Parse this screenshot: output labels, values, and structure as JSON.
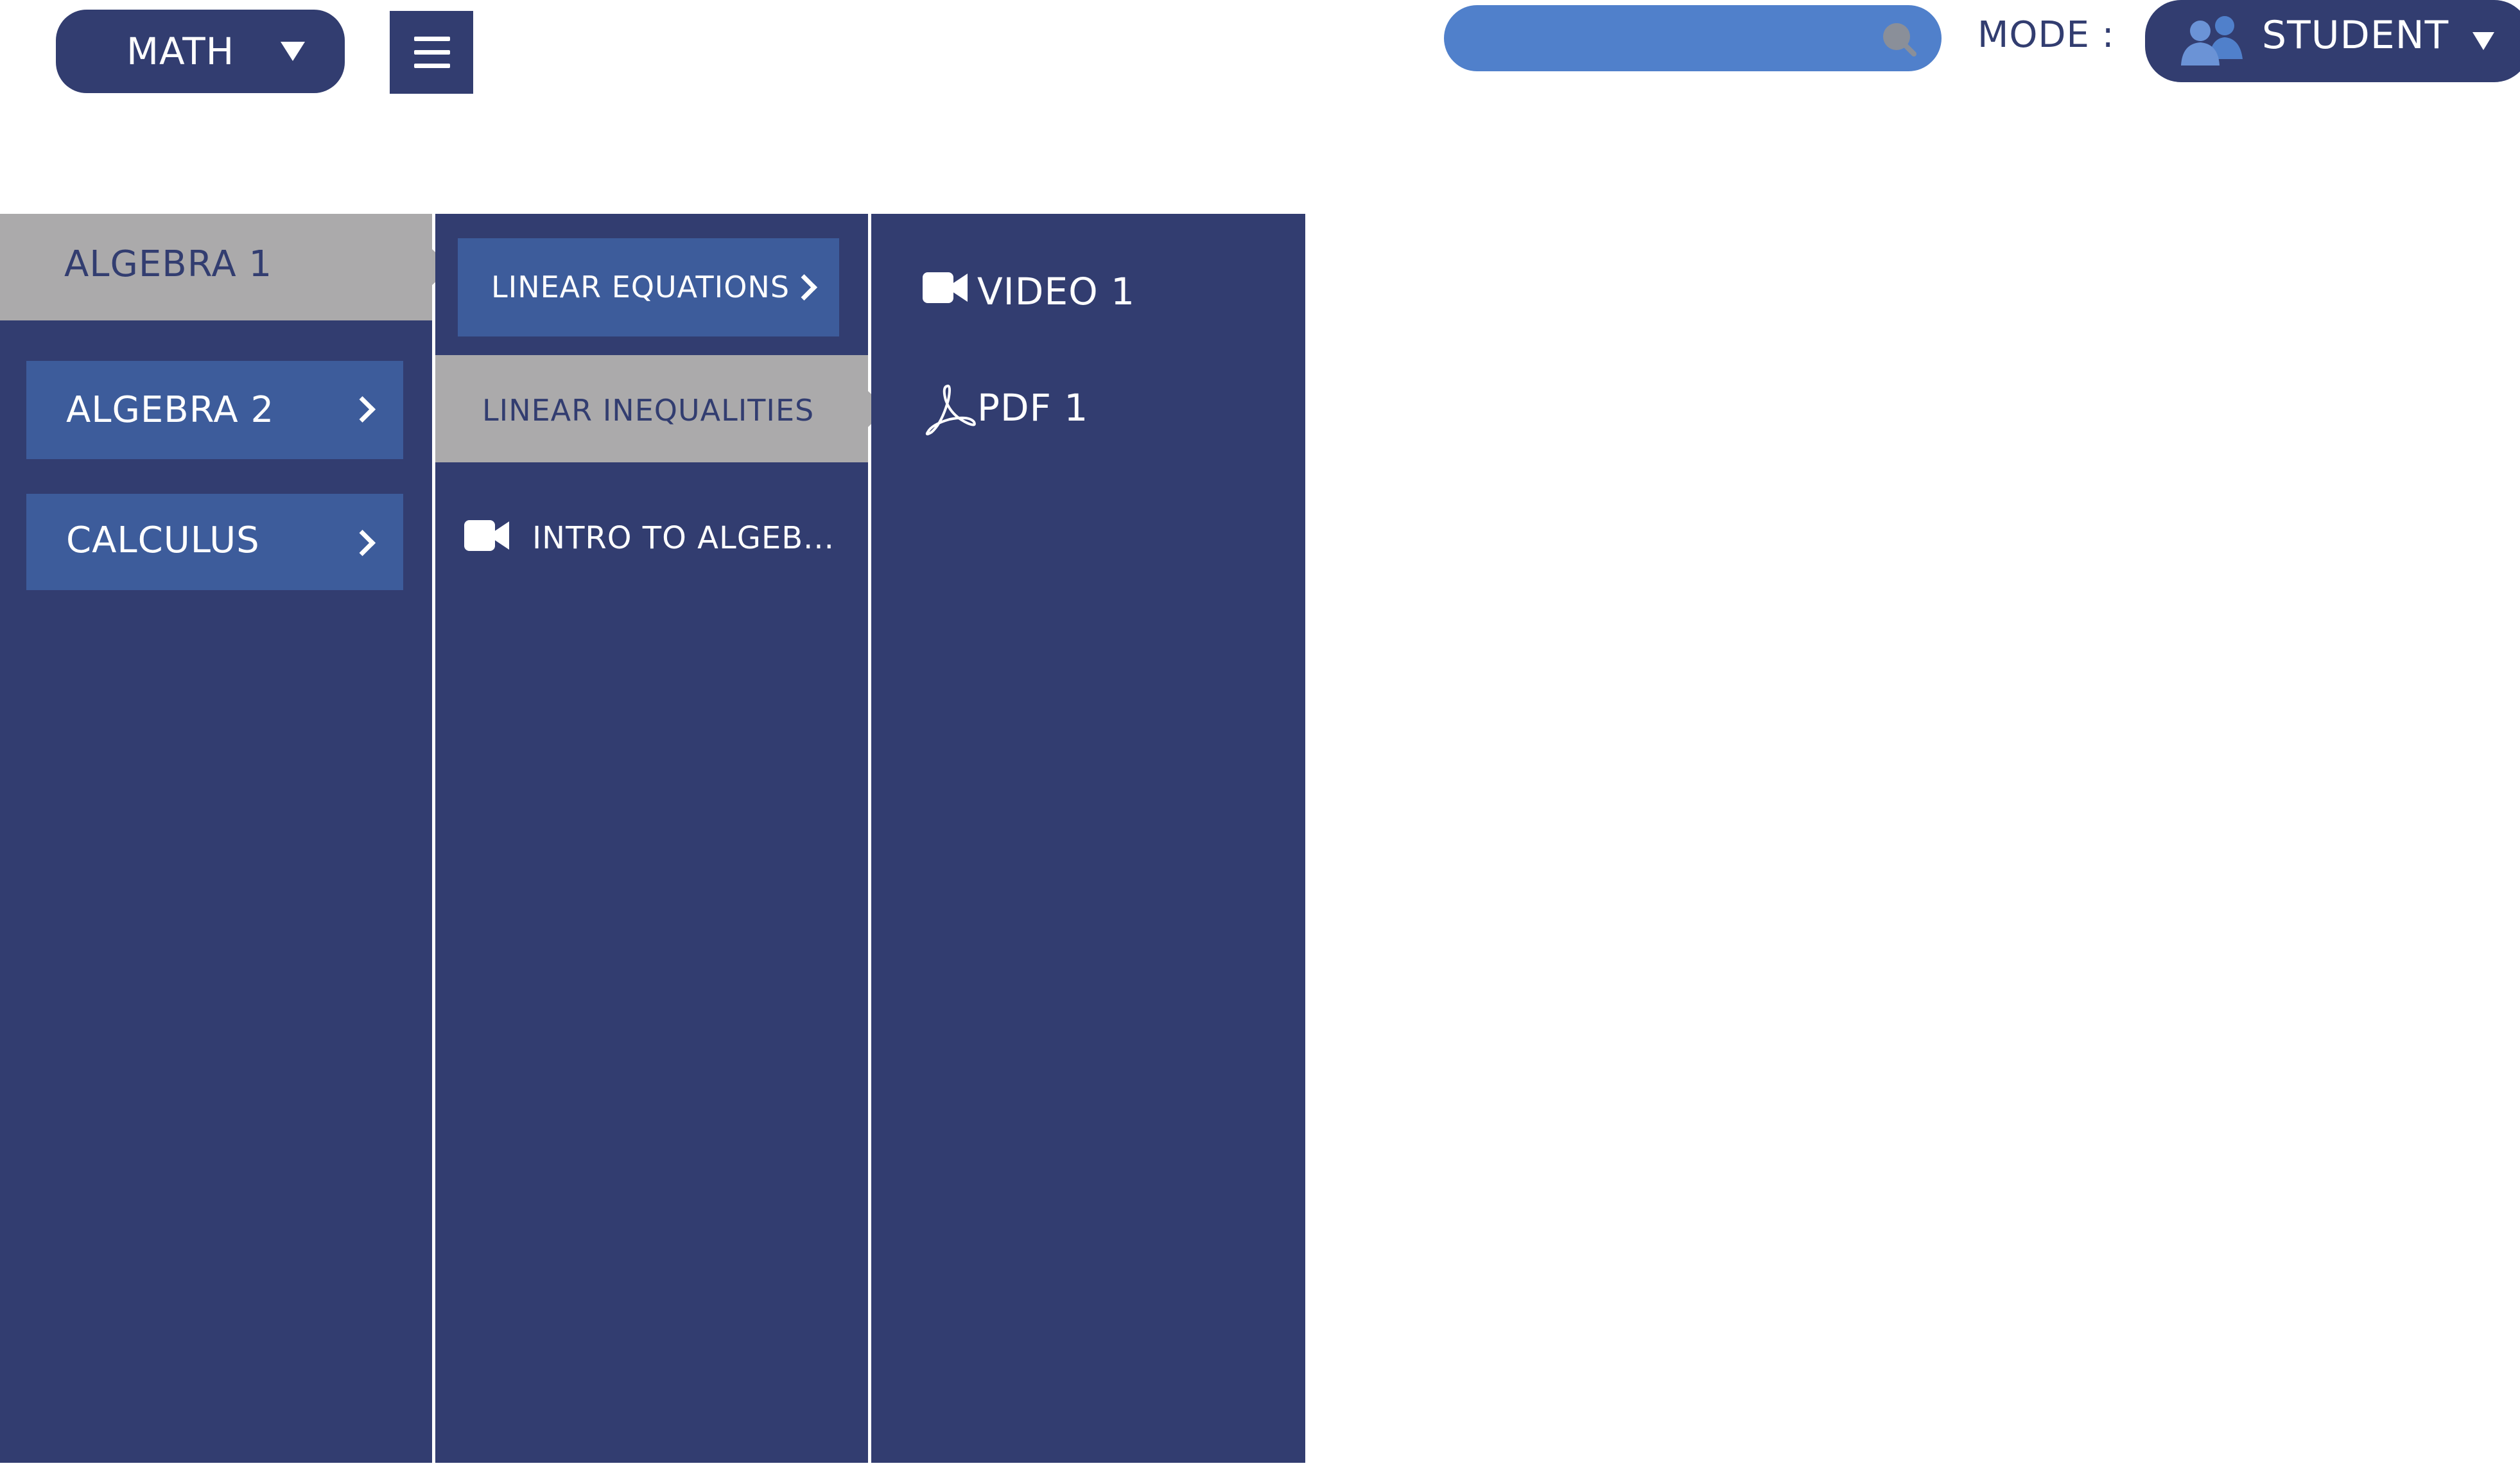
{
  "header": {
    "subject_select": "MATH",
    "search": {
      "value": "",
      "placeholder": ""
    },
    "mode_label": "MODE :",
    "mode_select": "STUDENT"
  },
  "columns": {
    "courses": [
      {
        "label": "ALGEBRA 1",
        "state": "selected"
      },
      {
        "label": "ALGEBRA 2",
        "state": "default"
      },
      {
        "label": "CALCULUS",
        "state": "default"
      }
    ],
    "topics": [
      {
        "label": "LINEAR EQUATIONS",
        "state": "default"
      },
      {
        "label": "LINEAR INEQUALITIES",
        "state": "selected"
      },
      {
        "label": "INTRO TO ALGEB...",
        "type": "video"
      }
    ],
    "resources": [
      {
        "label": "VIDEO 1",
        "type": "video"
      },
      {
        "label": "PDF 1",
        "type": "pdf"
      }
    ]
  },
  "colors": {
    "navy": "#323d70",
    "button_blue": "#3d5c9b",
    "search_blue": "#5080cb",
    "selected_gray": "#abaaab",
    "white": "#ffffff"
  },
  "icons": {
    "subject_caret": "caret-down-icon",
    "menu": "hamburger-menu-icon",
    "search": "search-icon",
    "mode_users": "users-icon",
    "mode_caret": "caret-down-icon",
    "chevron": "chevron-right-icon",
    "video": "video-camera-icon",
    "pdf": "pdf-icon"
  }
}
